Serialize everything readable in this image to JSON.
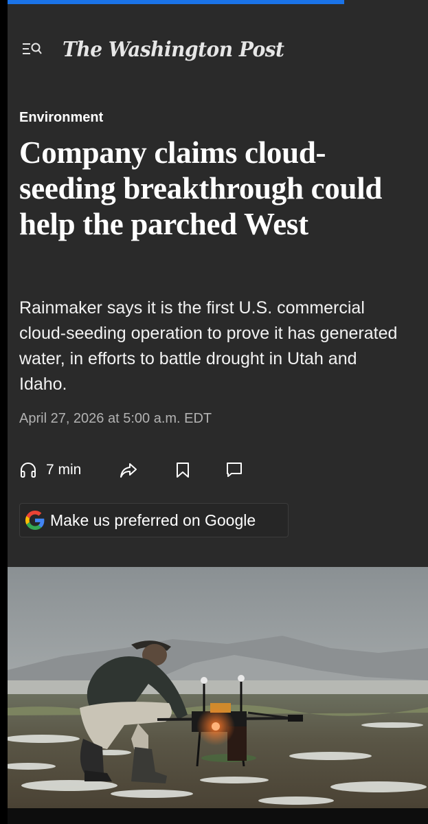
{
  "reading_progress": 0.8,
  "masthead": {
    "logo_text": "The Washington Post",
    "menu_icon": "menu-search-icon"
  },
  "article": {
    "section": "Environment",
    "headline": "Company claims cloud-seeding breakthrough could help the parched West",
    "dek": "Rainmaker says it is the first U.S. commercial cloud-seeding operation to prove it has generated water, in efforts to battle drought in Utah and Idaho.",
    "timestamp": "April 27, 2026 at 5:00 a.m. EDT"
  },
  "actions": {
    "listen_label": "7 min",
    "listen_icon": "headphones-icon",
    "share_icon": "share-icon",
    "save_icon": "bookmark-icon",
    "comment_icon": "comment-icon"
  },
  "google_button": {
    "label": "Make us preferred on Google",
    "icon": "google-icon"
  },
  "colors": {
    "article_background": "#2a2a2a",
    "progress_fill": "#1a73e8",
    "google_blue": "#4285F4",
    "google_red": "#EA4335",
    "google_yellow": "#FBBC05",
    "google_green": "#34A853"
  }
}
